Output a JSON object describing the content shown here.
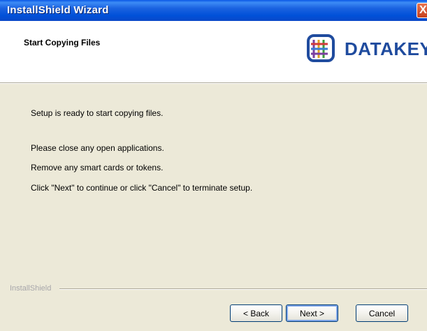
{
  "window": {
    "title": "InstallShield Wizard",
    "close_glyph": "X"
  },
  "header": {
    "title": "Start Copying Files",
    "logo_text": "DATAKEY"
  },
  "body": {
    "lines": [
      "Setup is ready to start copying files.",
      "Please close any open applications.",
      "Remove any smart cards or tokens.",
      "Click \"Next\" to continue or click \"Cancel\" to terminate setup."
    ]
  },
  "footer": {
    "brand": "InstallShield",
    "back_label": "< Back",
    "next_label": "Next >",
    "cancel_label": "Cancel"
  },
  "colors": {
    "titlebar": "#0a58e6",
    "dialog_bg": "#ece9d8",
    "logo_blue": "#1f4b9e"
  }
}
